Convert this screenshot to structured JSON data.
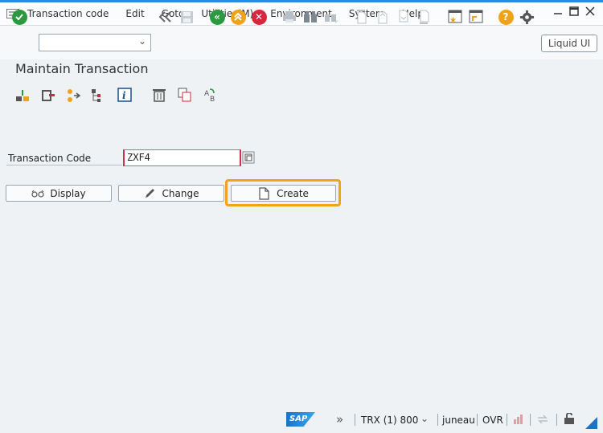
{
  "menubar": {
    "items": [
      "Transaction code",
      "Edit",
      "Goto",
      "Utilities(M)",
      "Environment",
      "System",
      "Help"
    ]
  },
  "toolbar": {
    "command_field_value": "",
    "liquid_ui_label": "Liquid UI"
  },
  "page": {
    "title": "Maintain Transaction"
  },
  "form": {
    "transaction_code_label": "Transaction Code",
    "transaction_code_value": "ZXF4"
  },
  "buttons": {
    "display": "Display",
    "change": "Change",
    "create": "Create"
  },
  "statusbar": {
    "sap_logo": "SAP",
    "system_info": "TRX (1) 800",
    "server": "juneau",
    "mode": "OVR"
  },
  "colors": {
    "highlight": "#f5a21b",
    "sap_blue": "#1a73c6",
    "required_field_marker": "#d22d4c"
  }
}
